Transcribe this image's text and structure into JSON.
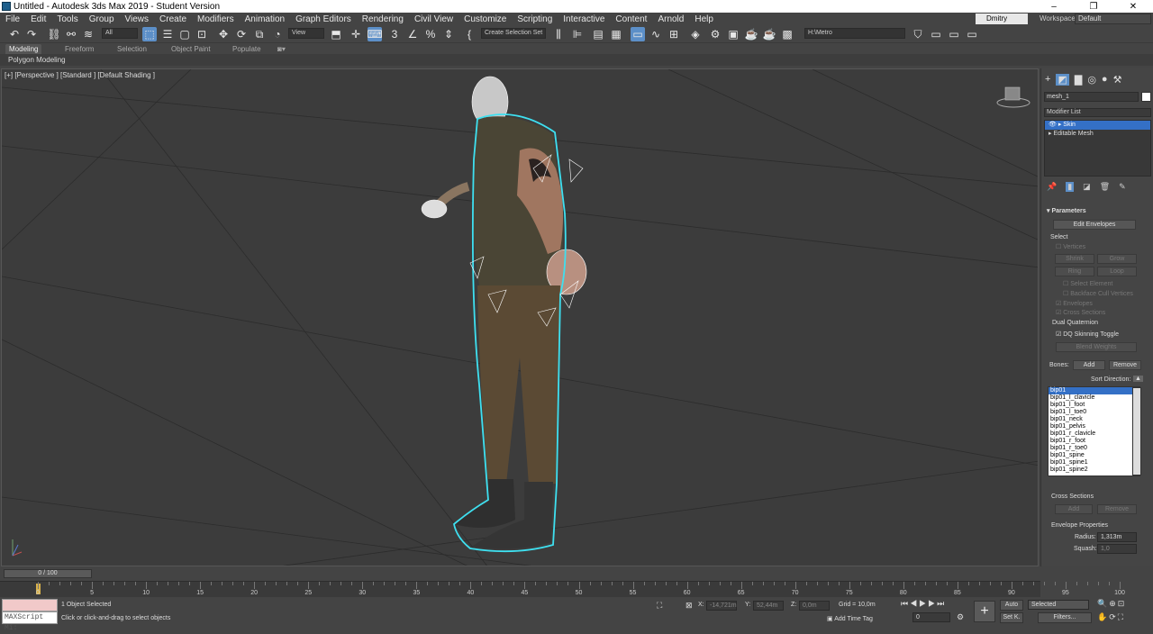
{
  "window": {
    "title": "Untitled - Autodesk 3ds Max 2019 - Student Version",
    "minimize": "–",
    "restore": "❐",
    "close": "✕"
  },
  "menu": [
    "File",
    "Edit",
    "Tools",
    "Group",
    "Views",
    "Create",
    "Modifiers",
    "Animation",
    "Graph Editors",
    "Rendering",
    "Civil View",
    "Customize",
    "Scripting",
    "Interactive",
    "Content",
    "Arnold",
    "Help"
  ],
  "user": "Dmitry Popo...",
  "workspaces_label": "Workspaces:",
  "workspace": "Default",
  "toolbar": {
    "selection_filter": "All",
    "ref_coord": "View",
    "named_selection": "Create Selection Set",
    "path": "H:\\Metro"
  },
  "ribbon": {
    "tabs": [
      "Modeling",
      "Freeform",
      "Selection",
      "Object Paint",
      "Populate"
    ],
    "active": "Modeling",
    "sub": "Polygon Modeling"
  },
  "viewport": {
    "label": "[+] [Perspective ] [Standard ] [Default Shading ]"
  },
  "command_panel": {
    "object_name": "mesh_1",
    "modifier_list": "Modifier List",
    "stack": [
      "Skin",
      "Editable Mesh"
    ],
    "rollout_title": "Parameters",
    "edit_envelopes": "Edit Envelopes",
    "select_label": "Select",
    "vertices": "Vertices",
    "shrink": "Shrink",
    "grow": "Grow",
    "ring": "Ring",
    "loop": "Loop",
    "select_element": "Select Element",
    "backface": "Backface Cull Vertices",
    "envelopes": "Envelopes",
    "cross_sections": "Cross Sections",
    "dual_quaternion": "Dual Quaternion",
    "dq_toggle": "DQ Skinning Toggle",
    "blend_weights": "Blend Weights",
    "bones_label": "Bones:",
    "add": "Add",
    "remove": "Remove",
    "sort_direction": "Sort Direction:",
    "bones": [
      "bip01",
      "bip01_l_clavicle",
      "bip01_l_foot",
      "bip01_l_toe0",
      "bip01_neck",
      "bip01_pelvis",
      "bip01_r_clavicle",
      "bip01_r_foot",
      "bip01_r_toe0",
      "bip01_spine",
      "bip01_spine1",
      "bip01_spine2"
    ],
    "cross_sections_title": "Cross Sections",
    "cs_add": "Add",
    "cs_remove": "Remove",
    "envelope_props": "Envelope Properties",
    "radius_label": "Radius:",
    "radius": "1,313m",
    "squash_label": "Squash:",
    "squash": "1,0"
  },
  "timeline": {
    "frame": "0 / 100",
    "ticks": [
      "0",
      "5",
      "10",
      "15",
      "20",
      "25",
      "30",
      "35",
      "40",
      "45",
      "50",
      "55",
      "60",
      "65",
      "70",
      "75",
      "80",
      "85",
      "90",
      "95",
      "100"
    ]
  },
  "status": {
    "maxscript": "MAXScript Mi:",
    "selected": "1 Object Selected",
    "prompt": "Click or click-and-drag to select objects",
    "x_label": "X:",
    "x": "-14,721m",
    "y_label": "Y:",
    "y": "52,44m",
    "z_label": "Z:",
    "z": "0,0m",
    "grid": "Grid = 10,0m",
    "add_time_tag": "Add Time Tag",
    "auto": "Auto",
    "set_k": "Set K.",
    "selected_drop": "Selected",
    "filters": "Filters...",
    "frame_field": "0"
  }
}
